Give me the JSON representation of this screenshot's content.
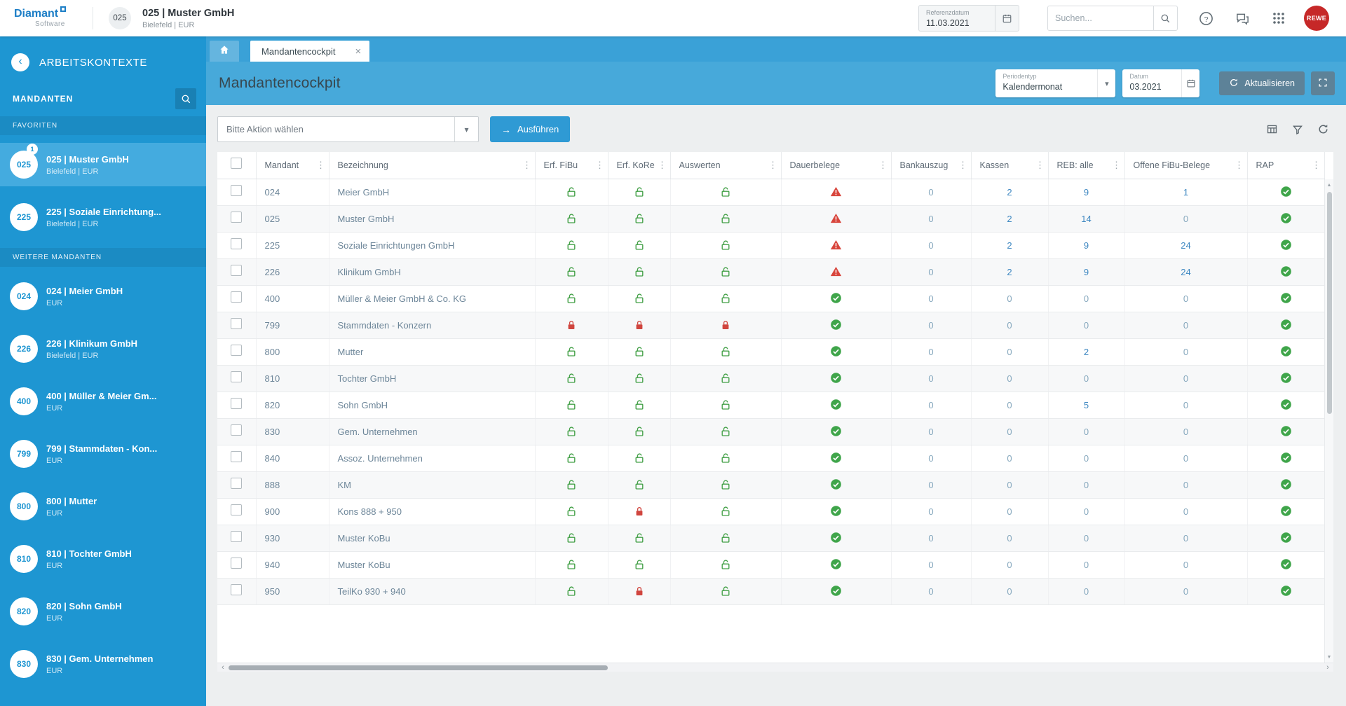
{
  "topbar": {
    "logo": {
      "line1": "Diamant",
      "line2": "Software"
    },
    "client_badge": "025",
    "title": "025 | Muster GmbH",
    "subtitle": "Bielefeld | EUR",
    "referenzdatum": {
      "label": "Referenzdatum",
      "value": "11.03.2021"
    },
    "search": {
      "placeholder": "Suchen..."
    },
    "user_badge": "REWE"
  },
  "sidebar": {
    "title": "ARBEITSKONTEXTE",
    "section_label": "MANDANTEN",
    "groups": [
      {
        "label": "FAVORITEN",
        "items": [
          {
            "code": "025",
            "badge": "1",
            "title": "025 | Muster GmbH",
            "subtitle": "Bielefeld | EUR",
            "selected": true
          },
          {
            "code": "225",
            "title": "225 | Soziale Einrichtung...",
            "subtitle": "Bielefeld | EUR",
            "selected": false
          }
        ]
      },
      {
        "label": "WEITERE MANDANTEN",
        "items": [
          {
            "code": "024",
            "title": "024 | Meier GmbH",
            "subtitle": "EUR",
            "selected": false
          },
          {
            "code": "226",
            "title": "226 | Klinikum GmbH",
            "subtitle": "Bielefeld | EUR",
            "selected": false
          },
          {
            "code": "400",
            "title": "400 | Müller & Meier Gm...",
            "subtitle": "EUR",
            "selected": false
          },
          {
            "code": "799",
            "title": "799 | Stammdaten - Kon...",
            "subtitle": "EUR",
            "selected": false
          },
          {
            "code": "800",
            "title": "800 | Mutter",
            "subtitle": "EUR",
            "selected": false
          },
          {
            "code": "810",
            "title": "810 | Tochter GmbH",
            "subtitle": "EUR",
            "selected": false
          },
          {
            "code": "820",
            "title": "820 | Sohn GmbH",
            "subtitle": "EUR",
            "selected": false
          },
          {
            "code": "830",
            "title": "830 | Gem. Unternehmen",
            "subtitle": "EUR",
            "selected": false
          }
        ]
      }
    ]
  },
  "tabs": [
    {
      "label": "Mandantencockpit",
      "active": true
    }
  ],
  "page": {
    "title": "Mandantencockpit",
    "periodentyp": {
      "label": "Periodentyp",
      "value": "Kalendermonat"
    },
    "datum": {
      "label": "Datum",
      "value": "03.2021"
    },
    "refresh_button": "Aktualisieren"
  },
  "actionbar": {
    "select_placeholder": "Bitte Aktion wählen",
    "execute_button": "Ausführen"
  },
  "table": {
    "columns": [
      "Mandant",
      "Bezeichnung",
      "Erf. FiBu",
      "Erf. KoRe",
      "Auswerten",
      "Dauerbelege",
      "Bankauszug",
      "Kassen",
      "REB: alle",
      "Offene FiBu-Belege",
      "RAP"
    ],
    "rows": [
      {
        "mandant": "024",
        "bezeichnung": "Meier GmbH",
        "erf_fibu": "unlocked",
        "erf_kore": "unlocked",
        "auswerten": "unlocked",
        "dauerbelege": "warning",
        "bankauszug": "0",
        "kassen": "2",
        "reb_alle": "9",
        "offene_fibu_belege": "1",
        "rap": "ok"
      },
      {
        "mandant": "025",
        "bezeichnung": "Muster GmbH",
        "erf_fibu": "unlocked",
        "erf_kore": "unlocked",
        "auswerten": "unlocked",
        "dauerbelege": "warning",
        "bankauszug": "0",
        "kassen": "2",
        "reb_alle": "14",
        "offene_fibu_belege": "0",
        "rap": "ok"
      },
      {
        "mandant": "225",
        "bezeichnung": "Soziale Einrichtungen GmbH",
        "erf_fibu": "unlocked",
        "erf_kore": "unlocked",
        "auswerten": "unlocked",
        "dauerbelege": "warning",
        "bankauszug": "0",
        "kassen": "2",
        "reb_alle": "9",
        "offene_fibu_belege": "24",
        "rap": "ok"
      },
      {
        "mandant": "226",
        "bezeichnung": "Klinikum GmbH",
        "erf_fibu": "unlocked",
        "erf_kore": "unlocked",
        "auswerten": "unlocked",
        "dauerbelege": "warning",
        "bankauszug": "0",
        "kassen": "2",
        "reb_alle": "9",
        "offene_fibu_belege": "24",
        "rap": "ok"
      },
      {
        "mandant": "400",
        "bezeichnung": "Müller & Meier GmbH & Co. KG",
        "erf_fibu": "unlocked",
        "erf_kore": "unlocked",
        "auswerten": "unlocked",
        "dauerbelege": "ok",
        "bankauszug": "0",
        "kassen": "0",
        "reb_alle": "0",
        "offene_fibu_belege": "0",
        "rap": "ok"
      },
      {
        "mandant": "799",
        "bezeichnung": "Stammdaten - Konzern",
        "erf_fibu": "locked",
        "erf_kore": "locked",
        "auswerten": "locked",
        "dauerbelege": "ok",
        "bankauszug": "0",
        "kassen": "0",
        "reb_alle": "0",
        "offene_fibu_belege": "0",
        "rap": "ok"
      },
      {
        "mandant": "800",
        "bezeichnung": "Mutter",
        "erf_fibu": "unlocked",
        "erf_kore": "unlocked",
        "auswerten": "unlocked",
        "dauerbelege": "ok",
        "bankauszug": "0",
        "kassen": "0",
        "reb_alle": "2",
        "offene_fibu_belege": "0",
        "rap": "ok"
      },
      {
        "mandant": "810",
        "bezeichnung": "Tochter GmbH",
        "erf_fibu": "unlocked",
        "erf_kore": "unlocked",
        "auswerten": "unlocked",
        "dauerbelege": "ok",
        "bankauszug": "0",
        "kassen": "0",
        "reb_alle": "0",
        "offene_fibu_belege": "0",
        "rap": "ok"
      },
      {
        "mandant": "820",
        "bezeichnung": "Sohn GmbH",
        "erf_fibu": "unlocked",
        "erf_kore": "unlocked",
        "auswerten": "unlocked",
        "dauerbelege": "ok",
        "bankauszug": "0",
        "kassen": "0",
        "reb_alle": "5",
        "offene_fibu_belege": "0",
        "rap": "ok"
      },
      {
        "mandant": "830",
        "bezeichnung": "Gem. Unternehmen",
        "erf_fibu": "unlocked",
        "erf_kore": "unlocked",
        "auswerten": "unlocked",
        "dauerbelege": "ok",
        "bankauszug": "0",
        "kassen": "0",
        "reb_alle": "0",
        "offene_fibu_belege": "0",
        "rap": "ok"
      },
      {
        "mandant": "840",
        "bezeichnung": "Assoz. Unternehmen",
        "erf_fibu": "unlocked",
        "erf_kore": "unlocked",
        "auswerten": "unlocked",
        "dauerbelege": "ok",
        "bankauszug": "0",
        "kassen": "0",
        "reb_alle": "0",
        "offene_fibu_belege": "0",
        "rap": "ok"
      },
      {
        "mandant": "888",
        "bezeichnung": "KM",
        "erf_fibu": "unlocked",
        "erf_kore": "unlocked",
        "auswerten": "unlocked",
        "dauerbelege": "ok",
        "bankauszug": "0",
        "kassen": "0",
        "reb_alle": "0",
        "offene_fibu_belege": "0",
        "rap": "ok"
      },
      {
        "mandant": "900",
        "bezeichnung": "Kons 888 + 950",
        "erf_fibu": "unlocked",
        "erf_kore": "locked",
        "auswerten": "unlocked",
        "dauerbelege": "ok",
        "bankauszug": "0",
        "kassen": "0",
        "reb_alle": "0",
        "offene_fibu_belege": "0",
        "rap": "ok"
      },
      {
        "mandant": "930",
        "bezeichnung": "Muster KoBu",
        "erf_fibu": "unlocked",
        "erf_kore": "unlocked",
        "auswerten": "unlocked",
        "dauerbelege": "ok",
        "bankauszug": "0",
        "kassen": "0",
        "reb_alle": "0",
        "offene_fibu_belege": "0",
        "rap": "ok"
      },
      {
        "mandant": "940",
        "bezeichnung": "Muster KoBu",
        "erf_fibu": "unlocked",
        "erf_kore": "unlocked",
        "auswerten": "unlocked",
        "dauerbelege": "ok",
        "bankauszug": "0",
        "kassen": "0",
        "reb_alle": "0",
        "offene_fibu_belege": "0",
        "rap": "ok"
      },
      {
        "mandant": "950",
        "bezeichnung": "TeilKo 930 + 940",
        "erf_fibu": "unlocked",
        "erf_kore": "locked",
        "auswerten": "unlocked",
        "dauerbelege": "ok",
        "bankauszug": "0",
        "kassen": "0",
        "reb_alle": "0",
        "offene_fibu_belege": "0",
        "rap": "ok"
      }
    ]
  },
  "status_icons": {
    "unlocked": "lock-open-icon",
    "locked": "lock-closed-icon",
    "warning": "warning-triangle-icon",
    "ok": "check-circle-icon"
  },
  "colors": {
    "sidebar_blue": "#1e96d2",
    "selected_item_blue": "#44abdf",
    "tabstrip_blue": "#3aa1d7",
    "band_blue": "#47a9da",
    "accent_blue": "#2f9ad4",
    "button_slate": "#5d8298",
    "status_green": "#3fa54a",
    "status_red": "#d8453c",
    "user_badge_red": "#c62828"
  }
}
